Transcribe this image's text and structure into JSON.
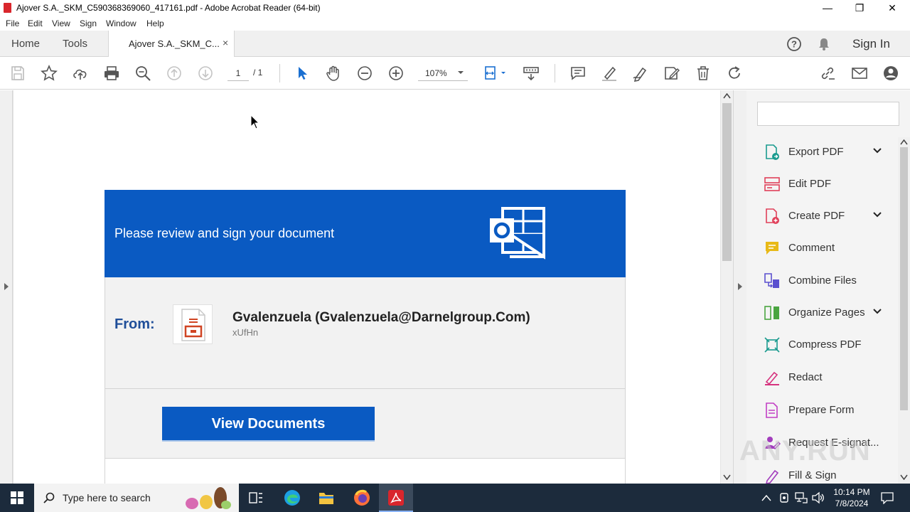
{
  "window": {
    "title": "Ajover S.A._SKM_C590368369060_417161.pdf - Adobe Acrobat Reader (64-bit)",
    "controls": {
      "minimize": "—",
      "maximize": "❐",
      "close": "✕"
    }
  },
  "menu": [
    "File",
    "Edit",
    "View",
    "Sign",
    "Window",
    "Help"
  ],
  "tabs": {
    "home": "Home",
    "tools": "Tools",
    "document": "Ajover S.A._SKM_C...",
    "close": "×",
    "sign_in": "Sign In"
  },
  "toolbar": {
    "page_current": "1",
    "page_total": "/ 1",
    "zoom": "107%"
  },
  "document": {
    "banner_text": "Please review and sign your document",
    "from_label": "From:",
    "sender": "Gvalenzuela (Gvalenzuela@Darnelgroup.Com)",
    "sender_sub": "xUfHn",
    "view_button": "View Documents"
  },
  "right_panel": {
    "tools": [
      {
        "label": "Export PDF",
        "icon": "export-pdf-icon",
        "color": "#1a9b8f",
        "expandable": true
      },
      {
        "label": "Edit PDF",
        "icon": "edit-pdf-icon",
        "color": "#e0405a",
        "expandable": false
      },
      {
        "label": "Create PDF",
        "icon": "create-pdf-icon",
        "color": "#e0405a",
        "expandable": true
      },
      {
        "label": "Comment",
        "icon": "comment-icon",
        "color": "#e8b917",
        "expandable": false
      },
      {
        "label": "Combine Files",
        "icon": "combine-files-icon",
        "color": "#5a4fcf",
        "expandable": false
      },
      {
        "label": "Organize Pages",
        "icon": "organize-pages-icon",
        "color": "#4aa540",
        "expandable": true
      },
      {
        "label": "Compress PDF",
        "icon": "compress-pdf-icon",
        "color": "#1a9b8f",
        "expandable": false
      },
      {
        "label": "Redact",
        "icon": "redact-icon",
        "color": "#d6337e",
        "expandable": false
      },
      {
        "label": "Prepare Form",
        "icon": "prepare-form-icon",
        "color": "#c23fc4",
        "expandable": false
      },
      {
        "label": "Request E-signat...",
        "icon": "request-esign-icon",
        "color": "#a23dbd",
        "expandable": false
      },
      {
        "label": "Fill & Sign",
        "icon": "fill-sign-icon",
        "color": "#a23dbd",
        "expandable": false
      }
    ]
  },
  "taskbar": {
    "search_placeholder": "Type here to search",
    "time": "10:14 PM",
    "date": "7/8/2024"
  },
  "watermark": "ANY.RUN"
}
